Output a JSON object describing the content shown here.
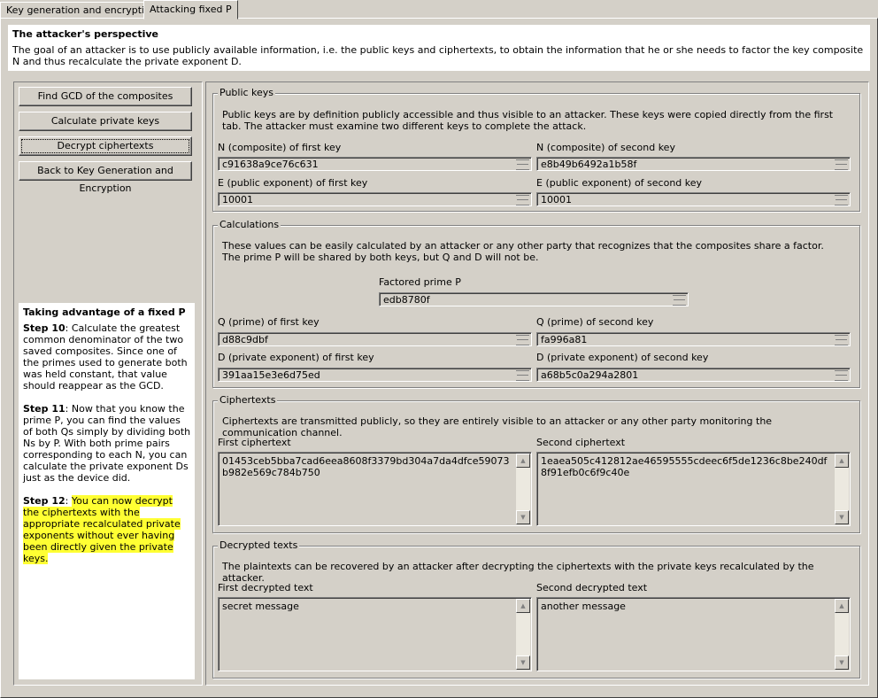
{
  "tabs": [
    {
      "label": "Key generation and encryption"
    },
    {
      "label": "Attacking fixed P"
    }
  ],
  "header": {
    "title": "The attacker's perspective",
    "text": "The goal of an attacker is to use publicly available information, i.e. the public keys and ciphertexts, to obtain the information that he or she needs to factor the key composite N and thus recalculate the private exponent D."
  },
  "buttons": {
    "gcd": "Find GCD of the composites",
    "calc": "Calculate private keys",
    "decrypt": "Decrypt ciphertexts",
    "back": "Back to Key Generation and Encryption"
  },
  "steps": {
    "title": "Taking advantage of a fixed P",
    "step10_label": "Step 10",
    "step10_text": ": Calculate the greatest common denominator of the two saved composites. Since one of the primes used to generate both was held constant, that value should reappear as the GCD.",
    "step11_label": "Step 11",
    "step11_text": ": Now that you know the prime P, you can find the values of both Qs simply by dividing both Ns by P. With both prime pairs corresponding to each N, you can calculate the private exponent Ds just as the device did.",
    "step12_label": "Step 12",
    "step12_sep": ": ",
    "step12_text": "You can now decrypt the ciphertexts with the appropriate recalculated private exponents without ever having been directly given the private keys."
  },
  "public_keys": {
    "legend": "Public keys",
    "desc": "Public keys are by definition publicly accessible and thus visible to an attacker. These keys were copied directly from the first tab. The attacker must examine two different keys to complete the attack.",
    "n1_label": "N (composite) of first key",
    "n1_value": "c91638a9ce76c631",
    "n2_label": "N (composite) of second key",
    "n2_value": "e8b49b6492a1b58f",
    "e1_label": "E (public exponent) of first key",
    "e1_value": "10001",
    "e2_label": "E (public exponent) of second key",
    "e2_value": "10001"
  },
  "calculations": {
    "legend": "Calculations",
    "desc": "These values can be easily calculated by an attacker or any other party that recognizes that the composites share a factor. The prime P will be shared by both keys, but Q and D will not be.",
    "p_label": "Factored prime P",
    "p_value": "edb8780f",
    "q1_label": "Q (prime) of first key",
    "q1_value": "d88c9dbf",
    "q2_label": "Q (prime) of second key",
    "q2_value": "fa996a81",
    "d1_label": "D (private exponent) of first key",
    "d1_value": "391aa15e3e6d75ed",
    "d2_label": "D (private exponent) of second key",
    "d2_value": "a68b5c0a294a2801"
  },
  "ciphertexts": {
    "legend": "Ciphertexts",
    "desc": "Ciphertexts are transmitted publicly, so they are entirely visible to an attacker or any other party monitoring the communication channel.",
    "c1_label": "First ciphertext",
    "c1_value": "01453ceb5bba7cad6eea8608f3379bd304a7da4dfce59073b982e569c784b750",
    "c2_label": "Second ciphertext",
    "c2_value": "1eaea505c412812ae46595555cdeec6f5de1236c8be240df8f91efb0c6f9c40e"
  },
  "decrypted": {
    "legend": "Decrypted texts",
    "desc": "The plaintexts can be recovered by an attacker after decrypting the ciphertexts with the private keys recalculated by the attacker.",
    "m1_label": "First decrypted text",
    "m1_value": "secret message",
    "m2_label": "Second decrypted text",
    "m2_value": "another message"
  },
  "icons": {
    "spin": "spinner-icon",
    "scroll_up": "scroll-up-arrow-icon",
    "scroll_down": "scroll-down-arrow-icon"
  },
  "colors": {
    "window_bg": "#d4d0c8",
    "highlight": "#ffff33"
  }
}
